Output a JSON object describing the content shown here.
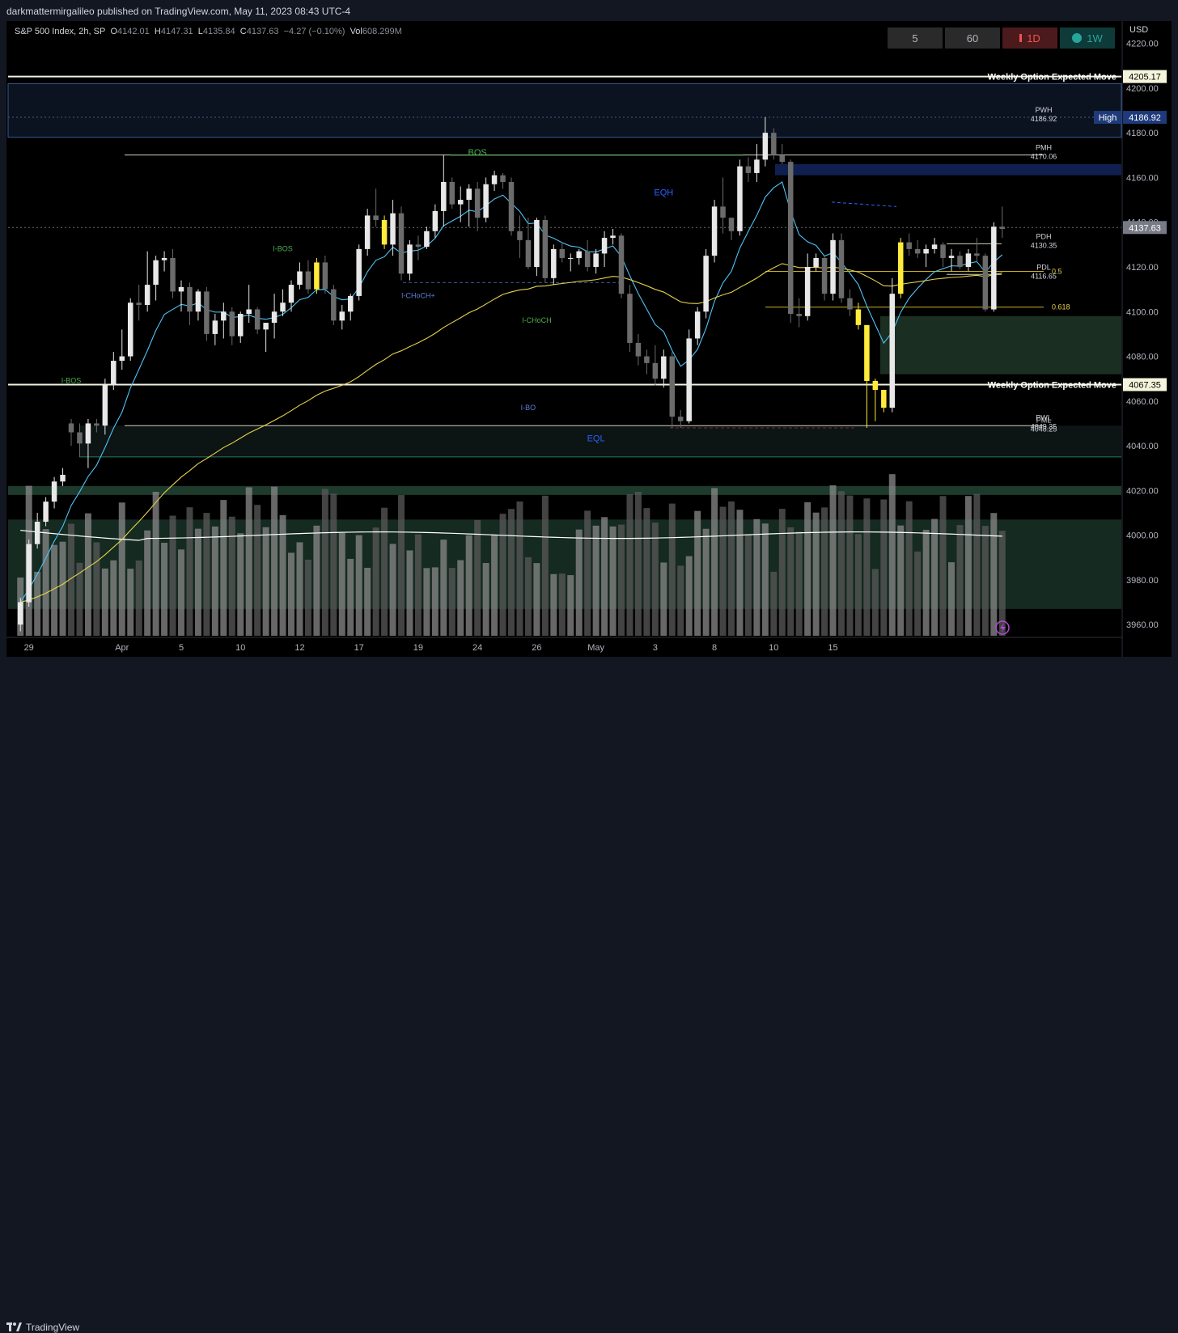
{
  "header": {
    "published": "darkmattermirgalileo published on TradingView.com, May 11, 2023 08:43 UTC-4"
  },
  "footer": {
    "brand": "TradingView"
  },
  "legend": {
    "symbol": "S&P 500 Index, 2h, SP",
    "o_label": "O",
    "o": "4142.01",
    "h_label": "H",
    "h": "4147.31",
    "l_label": "L",
    "l": "4135.84",
    "c_label": "C",
    "c": "4137.63",
    "change": "−4.27 (−0.10%)",
    "vol_label": "Vol",
    "vol": "608.299M"
  },
  "timeframes": [
    {
      "label": "5"
    },
    {
      "label": "60"
    },
    {
      "label": "1D"
    },
    {
      "label": "1W"
    }
  ],
  "colors": {
    "up": "#e8e8e8",
    "down": "#6b6b6b",
    "highlight": "#ffeb3b",
    "ema_fast": "#4fc3f7",
    "ema_slow": "#e6d24a",
    "vol_ma": "#ffffff"
  },
  "chart_data": {
    "type": "candlestick",
    "currency": "USD",
    "ylim": [
      3955,
      4230
    ],
    "y_ticks": [
      "4220.00",
      "4200.00",
      "4180.00",
      "4160.00",
      "4140.00",
      "4120.00",
      "4100.00",
      "4080.00",
      "4060.00",
      "4040.00",
      "4020.00",
      "4000.00",
      "3980.00",
      "3960.00"
    ],
    "x_ticks": [
      {
        "label": "29",
        "i": 1
      },
      {
        "label": "Apr",
        "i": 12
      },
      {
        "label": "5",
        "i": 19
      },
      {
        "label": "10",
        "i": 26
      },
      {
        "label": "12",
        "i": 33
      },
      {
        "label": "17",
        "i": 40
      },
      {
        "label": "19",
        "i": 47
      },
      {
        "label": "24",
        "i": 54
      },
      {
        "label": "26",
        "i": 61
      },
      {
        "label": "May",
        "i": 68
      },
      {
        "label": "3",
        "i": 75
      },
      {
        "label": "8",
        "i": 82
      },
      {
        "label": "10",
        "i": 89
      },
      {
        "label": "15",
        "i": 96
      }
    ],
    "price_badges": [
      {
        "label": "4205.17",
        "price": 4205.17,
        "style": "white"
      },
      {
        "label": "4186.92",
        "price": 4186.92,
        "style": "navy",
        "tag": "High"
      },
      {
        "label": "4137.63",
        "price": 4137.63,
        "style": "gray"
      },
      {
        "label": "4067.35",
        "price": 4067.35,
        "style": "white"
      }
    ],
    "levels": [
      {
        "label": "Weekly Option Expected Move",
        "price": 4205.17
      },
      {
        "label": "Weekly Option Expected Move",
        "price": 4067.35
      }
    ],
    "level_labels": [
      {
        "text": "PWH",
        "value": "4186.92",
        "price": 4186.92
      },
      {
        "text": "PMH",
        "value": "4170.06",
        "price": 4170.06
      },
      {
        "text": "PDH",
        "value": "4130.35",
        "price": 4130.35
      },
      {
        "text": "PDL",
        "value": "4116.65",
        "price": 4116.65
      },
      {
        "text": "PML",
        "value": "4048.25",
        "price": 4048.25
      },
      {
        "text": "PWL",
        "value": "4049.35",
        "price": 4049.35
      }
    ],
    "fib_labels": [
      {
        "text": "0.5",
        "price": 4118
      },
      {
        "text": "0.618",
        "price": 4102
      }
    ],
    "annotations": [
      {
        "text": "BOS",
        "i": 54,
        "price": 4170,
        "color": "#4caf50"
      },
      {
        "text": "I-BOS",
        "i": 31,
        "price": 4127,
        "color": "#4caf50"
      },
      {
        "text": "I-BOS",
        "i": 6,
        "price": 4068,
        "color": "#4caf50"
      },
      {
        "text": "I-CHoCH+",
        "i": 47,
        "price": 4106,
        "color": "#5b7fd6"
      },
      {
        "text": "I-CHoCH",
        "i": 61,
        "price": 4095,
        "color": "#4caf50"
      },
      {
        "text": "I-BO",
        "i": 60,
        "price": 4056,
        "color": "#5b7fd6"
      },
      {
        "text": "EQH",
        "i": 76,
        "price": 4152,
        "color": "#2962ff"
      },
      {
        "text": "EQL",
        "i": 68,
        "price": 4042,
        "color": "#2962ff"
      }
    ],
    "candles": [
      [
        3960,
        3972,
        3957,
        3970
      ],
      [
        3970,
        3998,
        3968,
        3996
      ],
      [
        3996,
        4010,
        3994,
        4006
      ],
      [
        4006,
        4017,
        4004,
        4015
      ],
      [
        4015,
        4026,
        4012,
        4024
      ],
      [
        4024,
        4030,
        4022,
        4027
      ],
      [
        4050,
        4052,
        4040,
        4046
      ],
      [
        4046,
        4050,
        4035,
        4041
      ],
      [
        4041,
        4052,
        4030,
        4050
      ],
      [
        4050,
        4052,
        4046,
        4049
      ],
      [
        4049,
        4070,
        4045,
        4067
      ],
      [
        4067,
        4082,
        4065,
        4078
      ],
      [
        4078,
        4092,
        4074,
        4080
      ],
      [
        4080,
        4106,
        4078,
        4104
      ],
      [
        4104,
        4112,
        4096,
        4103
      ],
      [
        4103,
        4127,
        4100,
        4112
      ],
      [
        4112,
        4125,
        4105,
        4123
      ],
      [
        4123,
        4127,
        4118,
        4124
      ],
      [
        4124,
        4128,
        4106,
        4109
      ],
      [
        4109,
        4114,
        4100,
        4111
      ],
      [
        4111,
        4113,
        4094,
        4100
      ],
      [
        4100,
        4110,
        4096,
        4109
      ],
      [
        4109,
        4111,
        4087,
        4090
      ],
      [
        4090,
        4099,
        4085,
        4096
      ],
      [
        4096,
        4104,
        4088,
        4100
      ],
      [
        4100,
        4102,
        4085,
        4089
      ],
      [
        4089,
        4100,
        4086,
        4099
      ],
      [
        4099,
        4112,
        4095,
        4101
      ],
      [
        4101,
        4102,
        4090,
        4092
      ],
      [
        4092,
        4095,
        4082,
        4095
      ],
      [
        4095,
        4108,
        4088,
        4100
      ],
      [
        4100,
        4110,
        4098,
        4104
      ],
      [
        4104,
        4114,
        4100,
        4112
      ],
      [
        4112,
        4122,
        4110,
        4118
      ],
      [
        4118,
        4123,
        4108,
        4110
      ],
      [
        4110,
        4124,
        4108,
        4122
      ],
      [
        4122,
        4125,
        4108,
        4110
      ],
      [
        4110,
        4112,
        4094,
        4096
      ],
      [
        4096,
        4103,
        4092,
        4100
      ],
      [
        4100,
        4108,
        4096,
        4107
      ],
      [
        4107,
        4130,
        4105,
        4128
      ],
      [
        4128,
        4146,
        4125,
        4143
      ],
      [
        4143,
        4155,
        4138,
        4141
      ],
      [
        4141,
        4143,
        4128,
        4130
      ],
      [
        4130,
        4150,
        4125,
        4144
      ],
      [
        4144,
        4147,
        4114,
        4117
      ],
      [
        4117,
        4132,
        4114,
        4130
      ],
      [
        4130,
        4134,
        4123,
        4129
      ],
      [
        4129,
        4138,
        4128,
        4136
      ],
      [
        4136,
        4148,
        4133,
        4145
      ],
      [
        4145,
        4170,
        4138,
        4158
      ],
      [
        4158,
        4160,
        4146,
        4148
      ],
      [
        4148,
        4156,
        4140,
        4150
      ],
      [
        4150,
        4157,
        4138,
        4155
      ],
      [
        4155,
        4158,
        4136,
        4142
      ],
      [
        4142,
        4160,
        4140,
        4157
      ],
      [
        4157,
        4163,
        4154,
        4161
      ],
      [
        4161,
        4162,
        4155,
        4158
      ],
      [
        4158,
        4160,
        4134,
        4136
      ],
      [
        4136,
        4143,
        4124,
        4132
      ],
      [
        4132,
        4142,
        4119,
        4120
      ],
      [
        4120,
        4142,
        4116,
        4141
      ],
      [
        4141,
        4143,
        4113,
        4115
      ],
      [
        4115,
        4130,
        4112,
        4128
      ],
      [
        4128,
        4131,
        4122,
        4124
      ],
      [
        4124,
        4126,
        4118,
        4124
      ],
      [
        4124,
        4128,
        4121,
        4127
      ],
      [
        4127,
        4132,
        4118,
        4120
      ],
      [
        4120,
        4128,
        4117,
        4126
      ],
      [
        4126,
        4136,
        4120,
        4133
      ],
      [
        4133,
        4137,
        4130,
        4134
      ],
      [
        4134,
        4135,
        4106,
        4108
      ],
      [
        4108,
        4112,
        4082,
        4086
      ],
      [
        4086,
        4090,
        4076,
        4080
      ],
      [
        4080,
        4083,
        4072,
        4077
      ],
      [
        4077,
        4085,
        4067,
        4070
      ],
      [
        4070,
        4083,
        4066,
        4080
      ],
      [
        4080,
        4082,
        4048,
        4053
      ],
      [
        4053,
        4056,
        4048,
        4051
      ],
      [
        4051,
        4092,
        4050,
        4088
      ],
      [
        4088,
        4102,
        4085,
        4100
      ],
      [
        4100,
        4128,
        4097,
        4125
      ],
      [
        4125,
        4150,
        4122,
        4147
      ],
      [
        4147,
        4160,
        4135,
        4142
      ],
      [
        4142,
        4140,
        4132,
        4136
      ],
      [
        4136,
        4168,
        4134,
        4165
      ],
      [
        4165,
        4169,
        4158,
        4162
      ],
      [
        4162,
        4175,
        4158,
        4168
      ],
      [
        4168,
        4187,
        4165,
        4180
      ],
      [
        4180,
        4182,
        4168,
        4170
      ],
      [
        4170,
        4175,
        4166,
        4167
      ],
      [
        4167,
        4168,
        4095,
        4099
      ],
      [
        4099,
        4106,
        4093,
        4098
      ],
      [
        4098,
        4126,
        4096,
        4120
      ],
      [
        4120,
        4126,
        4118,
        4124
      ],
      [
        4124,
        4125,
        4105,
        4108
      ],
      [
        4108,
        4135,
        4105,
        4132
      ],
      [
        4132,
        4135,
        4104,
        4106
      ],
      [
        4106,
        4110,
        4098,
        4101
      ],
      [
        4101,
        4104,
        4092,
        4094
      ],
      [
        4094,
        4084,
        4048,
        4069
      ],
      [
        4069,
        4070,
        4051,
        4065
      ],
      [
        4065,
        4064,
        4055,
        4057
      ],
      [
        4057,
        4115,
        4055,
        4108
      ],
      [
        4108,
        4133,
        4106,
        4131
      ],
      [
        4131,
        4135,
        4125,
        4128
      ],
      [
        4128,
        4132,
        4124,
        4126
      ],
      [
        4126,
        4130,
        4120,
        4128
      ],
      [
        4128,
        4133,
        4126,
        4130
      ],
      [
        4130,
        4131,
        4120,
        4124
      ],
      [
        4124,
        4128,
        4118,
        4125
      ],
      [
        4125,
        4127,
        4119,
        4120
      ],
      [
        4120,
        4128,
        4118,
        4126
      ],
      [
        4126,
        4133,
        4122,
        4125
      ],
      [
        4125,
        4126,
        4100,
        4101
      ],
      [
        4101,
        4140,
        4100,
        4138
      ],
      [
        4138,
        4147,
        4133,
        4137
      ]
    ],
    "highlight_idx": [
      35,
      43,
      99,
      100,
      101,
      102,
      104
    ]
  }
}
